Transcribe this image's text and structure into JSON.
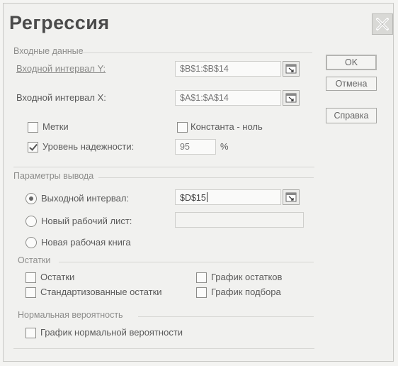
{
  "dialog": {
    "title": "Регрессия"
  },
  "input": {
    "section_label": "Входные данные",
    "y_label": "Входной интервал Y:",
    "y_value": "$B$1:$B$14",
    "x_label": "Входной интервал X:",
    "x_value": "$A$1:$A$14",
    "labels_label": "Метки",
    "labels_checked": false,
    "const_zero_label": "Константа - ноль",
    "const_zero_checked": false,
    "confidence_label": "Уровень надежности:",
    "confidence_checked": true,
    "confidence_value": "95",
    "confidence_unit": "%"
  },
  "output": {
    "section_label": "Параметры вывода",
    "range_label": "Выходной интервал:",
    "range_value": "$D$15",
    "new_sheet_label": "Новый рабочий лист:",
    "new_sheet_value": "",
    "new_book_label": "Новая рабочая книга",
    "selected": "range"
  },
  "residuals": {
    "section_label": "Остатки",
    "residuals_label": "Остатки",
    "std_residuals_label": "Стандартизованные остатки",
    "residual_plot_label": "График остатков",
    "line_fit_label": "График подбора"
  },
  "normal": {
    "section_label": "Нормальная вероятность",
    "plot_label": "График нормальной вероятности"
  },
  "buttons": {
    "ok": "OK",
    "cancel": "Отмена",
    "help": "Справка"
  }
}
